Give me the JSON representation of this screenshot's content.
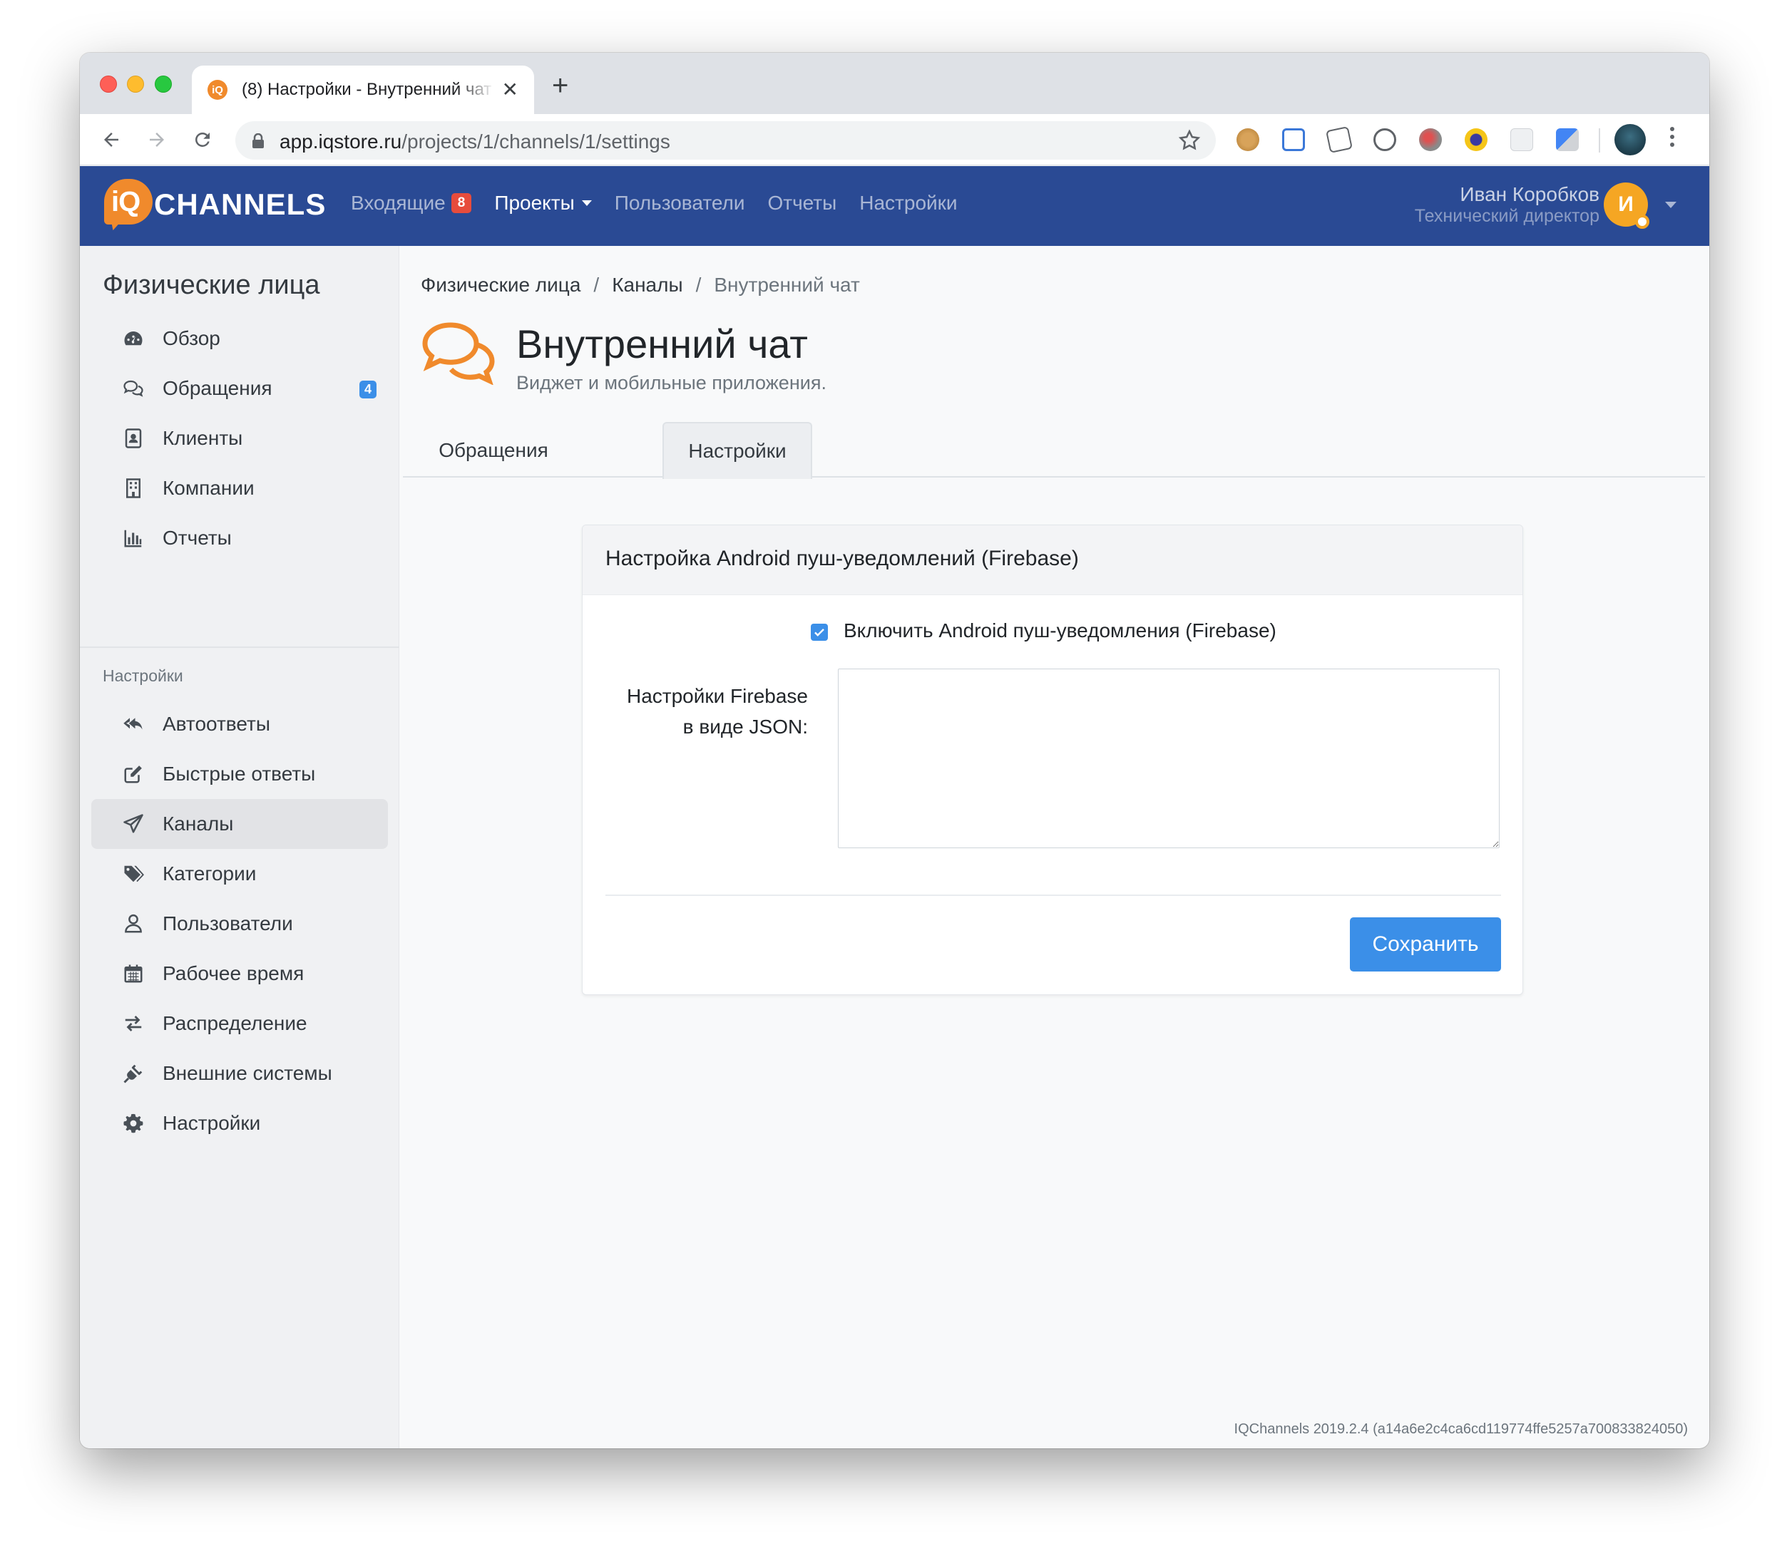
{
  "browser": {
    "tab_title": "(8) Настройки - Внутренний чат",
    "tab_favicon": "iQ",
    "url_host": "app.iqstore.ru",
    "url_path": "/projects/1/channels/1/settings"
  },
  "header": {
    "logo_iq": "iQ",
    "logo_text": "CHANNELS",
    "nav": [
      {
        "label": "Входящие",
        "badge": "8"
      },
      {
        "label": "Проекты"
      },
      {
        "label": "Пользователи"
      },
      {
        "label": "Отчеты"
      },
      {
        "label": "Настройки"
      }
    ],
    "user_name": "Иван Коробков",
    "user_role": "Технический директор",
    "avatar_letter": "И"
  },
  "sidebar": {
    "title": "Физические лица",
    "items": [
      {
        "label": "Обзор",
        "icon": "dashboard-icon"
      },
      {
        "label": "Обращения",
        "icon": "comments-icon",
        "badge": "4"
      },
      {
        "label": "Клиенты",
        "icon": "contact-card-icon"
      },
      {
        "label": "Компании",
        "icon": "building-icon"
      },
      {
        "label": "Отчеты",
        "icon": "bar-chart-icon"
      }
    ],
    "section_label": "Настройки",
    "settings_items": [
      {
        "label": "Автоответы",
        "icon": "reply-all-icon"
      },
      {
        "label": "Быстрые ответы",
        "icon": "edit-icon"
      },
      {
        "label": "Каналы",
        "icon": "paper-plane-icon"
      },
      {
        "label": "Категории",
        "icon": "tags-icon"
      },
      {
        "label": "Пользователи",
        "icon": "user-icon"
      },
      {
        "label": "Рабочее время",
        "icon": "calendar-icon"
      },
      {
        "label": "Распределение",
        "icon": "exchange-icon"
      },
      {
        "label": "Внешние системы",
        "icon": "plug-icon"
      },
      {
        "label": "Настройки",
        "icon": "cog-icon"
      }
    ]
  },
  "breadcrumb": [
    "Физические лица",
    "Каналы",
    "Внутренний чат"
  ],
  "page": {
    "title": "Внутренний чат",
    "subtitle": "Виджет и мобильные приложения.",
    "tabs": [
      "Обращения",
      "Настройки"
    ]
  },
  "card": {
    "title": "Настройка Android пуш-уведомлений (Firebase)",
    "checkbox_label": "Включить Android пуш-уведомления (Firebase)",
    "checkbox_checked": true,
    "field_label_line1": "Настройки Firebase",
    "field_label_line2": "в виде JSON:",
    "field_value": "",
    "save_label": "Сохранить"
  },
  "footer": "IQChannels 2019.2.4 (a14a6e2c4ca6cd119774ffe5257a700833824050)",
  "colors": {
    "header_bg": "#2a4a94",
    "accent": "#3b8fe8",
    "logo_orange": "#f08a2c",
    "badge_red": "#e74c3c"
  }
}
